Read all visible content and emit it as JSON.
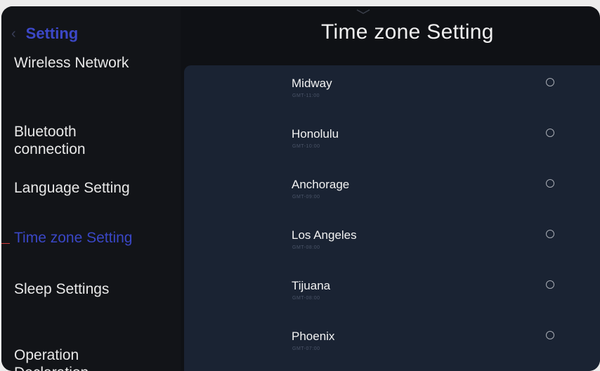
{
  "sidebar": {
    "back_label": "Setting",
    "items": [
      {
        "label": "Wireless Network"
      },
      {
        "label": "Bluetooth\nconnection"
      },
      {
        "label": "Language Setting"
      },
      {
        "label": "Time zone Setting"
      },
      {
        "label": "Sleep Settings"
      },
      {
        "label": "Operation\nDeclaration"
      }
    ],
    "active_index": 3
  },
  "header": {
    "title": "Time zone Setting"
  },
  "timezones": [
    {
      "name": "Midway",
      "offset": "GMT-11:00"
    },
    {
      "name": "Honolulu",
      "offset": "GMT-10:00"
    },
    {
      "name": "Anchorage",
      "offset": "GMT-09:00"
    },
    {
      "name": "Los Angeles",
      "offset": "GMT-08:00"
    },
    {
      "name": "Tijuana",
      "offset": "GMT-08:00"
    },
    {
      "name": "Phoenix",
      "offset": "GMT-07:00"
    }
  ],
  "colors": {
    "accent": "#3a47c6",
    "panel": "#1a2333",
    "background": "#0f1115"
  },
  "icons": {
    "back": "chevron-left-icon",
    "pull": "chevron-down-icon",
    "radio": "radio-unselected-icon"
  }
}
